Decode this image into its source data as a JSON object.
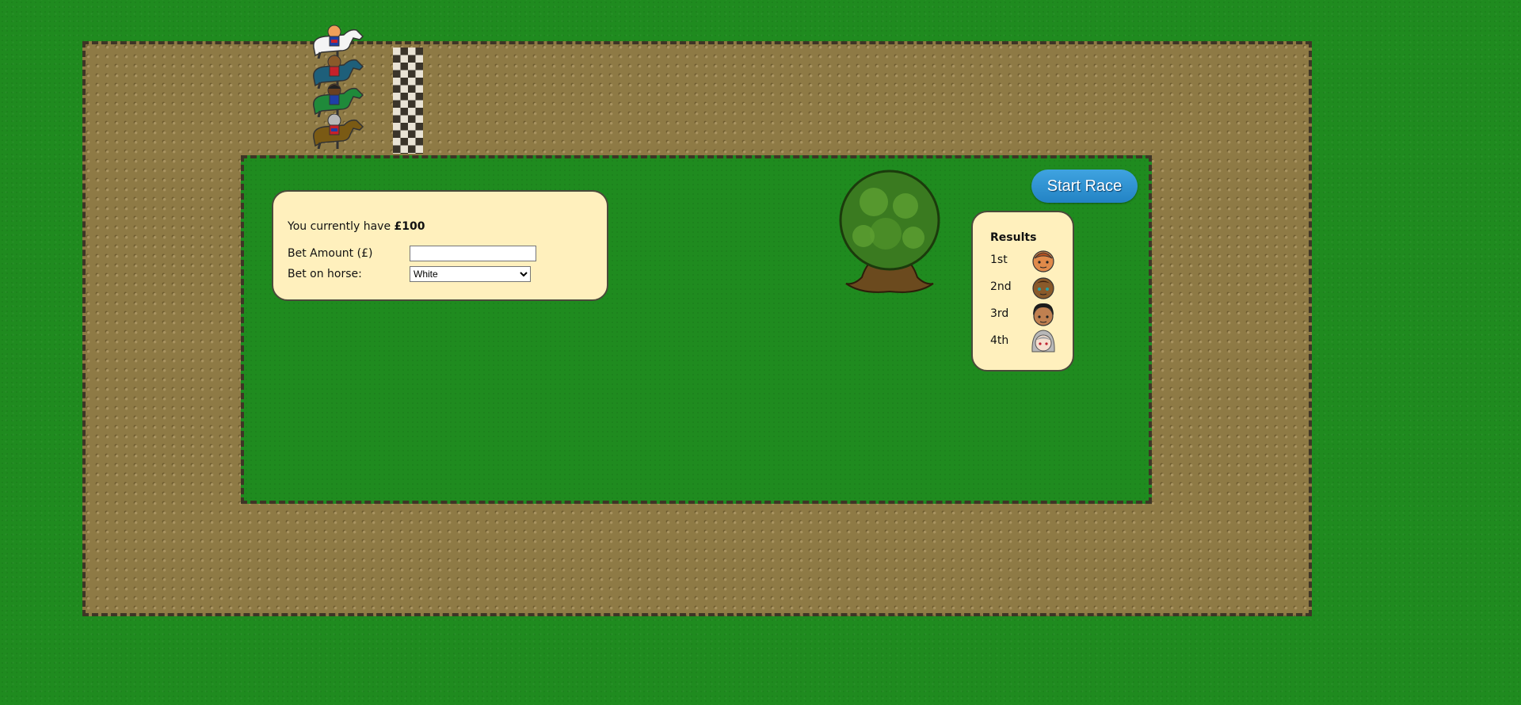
{
  "bet_panel": {
    "currency_text": "You currently have",
    "balance": "£100",
    "bet_amount_label": "Bet Amount (£)",
    "bet_amount_value": "",
    "bet_horse_label": "Bet on horse:",
    "selected_horse": "White"
  },
  "results": {
    "title": "Results",
    "places": [
      {
        "label": "1st",
        "rider": "bald-orange-jockey"
      },
      {
        "label": "2nd",
        "rider": "brown-jockey"
      },
      {
        "label": "3rd",
        "rider": "dark-haired-jockey"
      },
      {
        "label": "4th",
        "rider": "silver-haired-jockey"
      }
    ]
  },
  "start_button": {
    "label": "Start Race"
  },
  "horses": [
    {
      "color_name": "White",
      "body": "#f4f4f4",
      "rider_silks": "#1e3fa8"
    },
    {
      "color_name": "Blue",
      "body": "#1e5f7a",
      "rider_silks": "#c8202a"
    },
    {
      "color_name": "Green",
      "body": "#1f8a3a",
      "rider_silks": "#1e3fa8"
    },
    {
      "color_name": "Brown",
      "body": "#7a5a14",
      "rider_silks": "#c8202a"
    }
  ],
  "colors": {
    "grass": "#1f8b1f",
    "track": "#8e7a45",
    "panel": "#fff0bd",
    "button": "#2e93d3"
  }
}
